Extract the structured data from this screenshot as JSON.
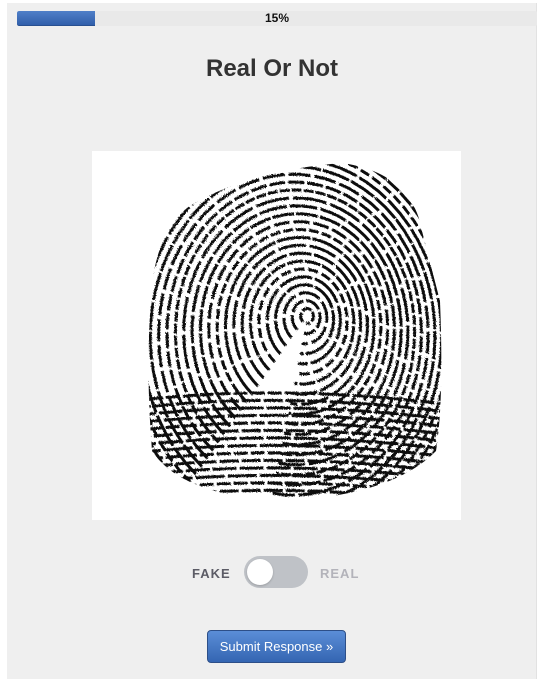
{
  "progress": {
    "value_percent": 15,
    "label": "15%",
    "fill_color": "#3a68b4"
  },
  "title": "Real Or Not",
  "image": {
    "icon": "fingerprint-image"
  },
  "toggle": {
    "left_label": "FAKE",
    "right_label": "REAL",
    "state": "off"
  },
  "submit": {
    "label": "Submit Response »",
    "color": "#3f72c0"
  }
}
